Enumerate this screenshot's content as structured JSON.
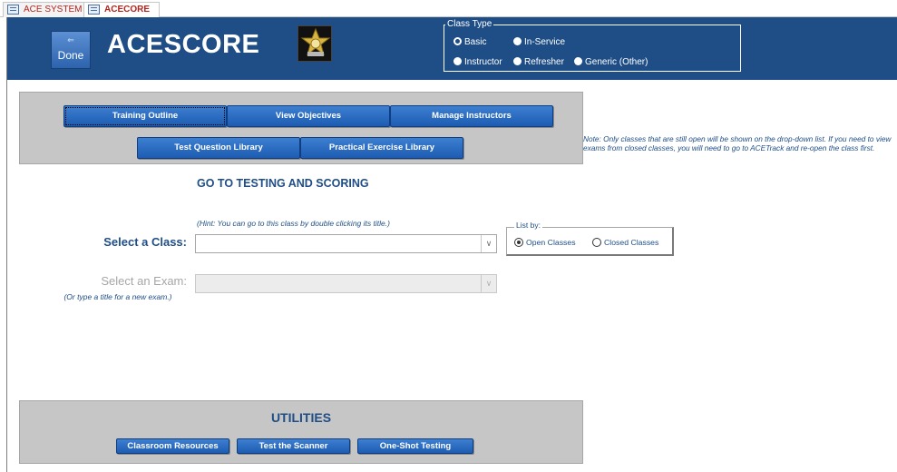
{
  "tabs": [
    {
      "label": "ACE SYSTEM",
      "active": false
    },
    {
      "label": "ACECORE",
      "active": true
    }
  ],
  "header": {
    "done_arrow": "⇐",
    "done_label": "Done",
    "title": "ACESCORE",
    "class_type": {
      "legend": "Class Type",
      "options": [
        {
          "label": "Basic",
          "selected": true
        },
        {
          "label": "In-Service",
          "selected": false
        },
        {
          "label": "Instructor",
          "selected": false
        },
        {
          "label": "Refresher",
          "selected": false
        },
        {
          "label": "Generic (Other)",
          "selected": false
        }
      ]
    }
  },
  "top_panel": {
    "buttons_row1": [
      "Training Outline",
      "View  Objectives",
      "Manage Instructors"
    ],
    "buttons_row2": [
      "Test Question Library",
      "Practical Exercise Library"
    ]
  },
  "note": "Note:  Only classes that are still open will be shown on the drop-down list. If you need to view exams from closed classes, you will need to go to ACETrack and re-open the class first.",
  "goto_heading": "GO TO TESTING AND SCORING",
  "hint": "(Hint:  You can go to this class by double clicking its title.)",
  "select_class": {
    "label": "Select a Class:",
    "value": ""
  },
  "list_by": {
    "legend": "List by:",
    "options": [
      {
        "label": "Open Classes",
        "selected": true
      },
      {
        "label": "Closed Classes",
        "selected": false
      }
    ]
  },
  "select_exam": {
    "label": "Select an Exam:",
    "value": "",
    "note": "(Or type a title for a new exam.)"
  },
  "utilities": {
    "title": "UTILITIES",
    "buttons": [
      "Classroom Resources",
      "Test the Scanner",
      "One-Shot Testing"
    ]
  },
  "colors": {
    "header_bg": "#1f4e86",
    "button_blue": "#2a6cc4",
    "panel_grey": "#c6c6c6",
    "label_blue": "#1f4e86"
  }
}
